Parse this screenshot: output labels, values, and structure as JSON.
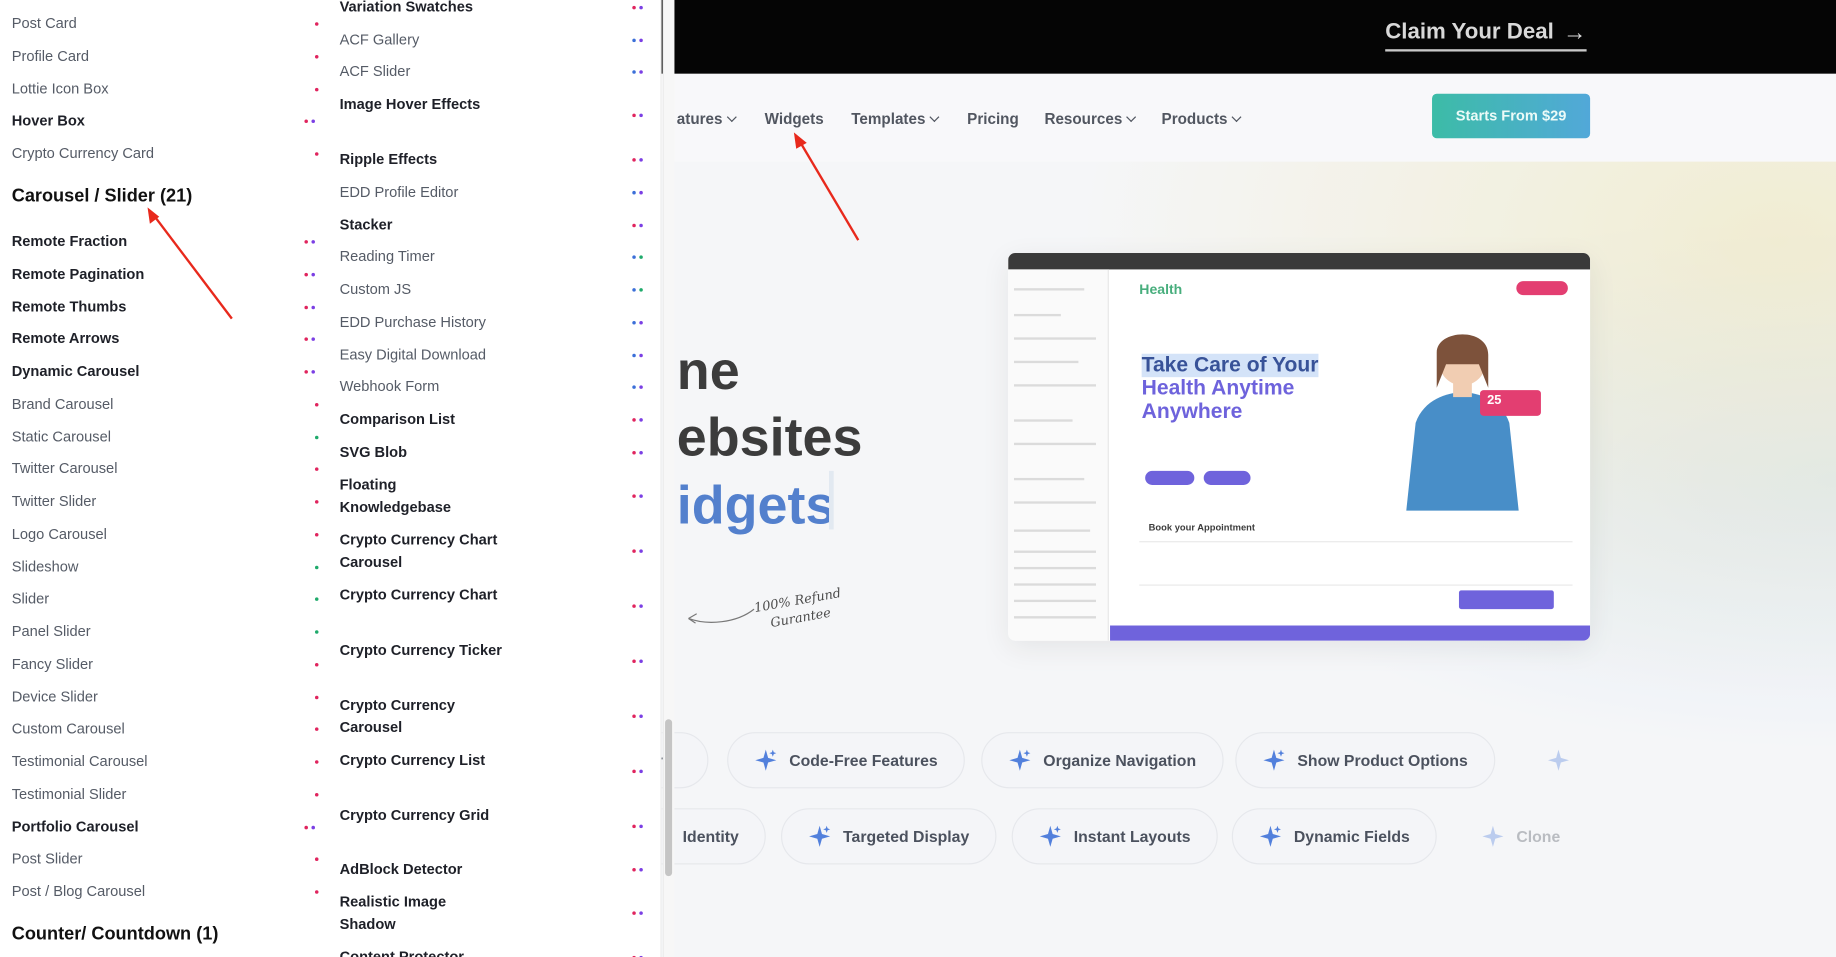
{
  "promo": {
    "claim_label": "Claim Your Deal",
    "arrow_glyph": "→"
  },
  "nav": {
    "items": [
      {
        "label": "atures",
        "dropdown": true
      },
      {
        "label": "Widgets",
        "dropdown": false
      },
      {
        "label": "Templates",
        "dropdown": true
      },
      {
        "label": "Pricing",
        "dropdown": false
      },
      {
        "label": "Resources",
        "dropdown": true
      },
      {
        "label": "Products",
        "dropdown": true
      }
    ],
    "cta_label": "Starts From $29"
  },
  "hero": {
    "line1": "ne",
    "line2": "ebsites",
    "line3": "idgets",
    "refund_line1": "100% Refund",
    "refund_line2": "Gurantee"
  },
  "preview": {
    "logo": "Health",
    "headline_1": "Take Care of Your",
    "headline_2": "Health Anytime",
    "headline_3": "Anywhere",
    "book_label": "Book your Appointment",
    "badge": "25"
  },
  "chips_row1": [
    "r",
    "Code-Free Features",
    "Organize Navigation",
    "Show Product Options"
  ],
  "chips_row2": [
    "Identity",
    "Targeted Display",
    "Instant Layouts",
    "Dynamic Fields",
    "Clone"
  ],
  "panel": {
    "col1_top": [
      {
        "label": "Post Card",
        "bold": false
      },
      {
        "label": "Profile Card",
        "bold": false
      },
      {
        "label": "Lottie Icon Box",
        "bold": false
      },
      {
        "label": "Hover Box",
        "bold": true
      },
      {
        "label": "Crypto Currency Card",
        "bold": false
      }
    ],
    "carousel_heading": "Carousel / Slider (21)",
    "col1_carousel": [
      {
        "label": "Remote Fraction",
        "bold": true
      },
      {
        "label": "Remote Pagination",
        "bold": true
      },
      {
        "label": "Remote Thumbs",
        "bold": true
      },
      {
        "label": "Remote Arrows",
        "bold": true
      },
      {
        "label": "Dynamic Carousel",
        "bold": true
      },
      {
        "label": "Brand Carousel",
        "bold": false
      },
      {
        "label": "Static Carousel",
        "bold": false
      },
      {
        "label": "Twitter Carousel",
        "bold": false
      },
      {
        "label": "Twitter Slider",
        "bold": false
      },
      {
        "label": "Logo Carousel",
        "bold": false
      },
      {
        "label": "Slideshow",
        "bold": false
      },
      {
        "label": "Slider",
        "bold": false
      },
      {
        "label": "Panel Slider",
        "bold": false
      },
      {
        "label": "Fancy Slider",
        "bold": false
      },
      {
        "label": "Device Slider",
        "bold": false
      },
      {
        "label": "Custom Carousel",
        "bold": false
      },
      {
        "label": "Testimonial Carousel",
        "bold": false
      },
      {
        "label": "Testimonial Slider",
        "bold": false
      },
      {
        "label": "Portfolio Carousel",
        "bold": true
      },
      {
        "label": "Post Slider",
        "bold": false
      },
      {
        "label": "Post / Blog Carousel",
        "bold": false
      }
    ],
    "counter_heading": "Counter/ Countdown (1)",
    "col2": [
      {
        "label": "Variation Swatches",
        "bold": true
      },
      {
        "label": "ACF Gallery",
        "bold": false
      },
      {
        "label": "ACF Slider",
        "bold": false
      },
      {
        "label": "Image Hover Effects",
        "bold": true
      },
      {
        "label": "Ripple Effects",
        "bold": true
      },
      {
        "label": "EDD Profile Editor",
        "bold": false
      },
      {
        "label": "Stacker",
        "bold": true
      },
      {
        "label": "Reading Timer",
        "bold": false
      },
      {
        "label": "Custom JS",
        "bold": false
      },
      {
        "label": "EDD Purchase History",
        "bold": false
      },
      {
        "label": "Easy Digital Download",
        "bold": false
      },
      {
        "label": "Webhook Form",
        "bold": false
      },
      {
        "label": "Comparison List",
        "bold": true
      },
      {
        "label": "SVG Blob",
        "bold": true
      },
      {
        "label": "Floating Knowledgebase",
        "bold": true
      },
      {
        "label": "Crypto Currency Chart Carousel",
        "bold": true
      },
      {
        "label": "Crypto Currency Chart",
        "bold": true
      },
      {
        "label": "Crypto Currency Ticker",
        "bold": true
      },
      {
        "label": "Crypto Currency Carousel",
        "bold": true
      },
      {
        "label": "Crypto Currency List",
        "bold": true
      },
      {
        "label": "Crypto Currency Grid",
        "bold": true
      },
      {
        "label": "AdBlock Detector",
        "bold": true
      },
      {
        "label": "Realistic Image Shadow",
        "bold": true
      },
      {
        "label": "Content Protector",
        "bold": true
      }
    ]
  },
  "colors": {
    "dot_pink": "#e0245e",
    "dot_purple": "#7b3fe4",
    "dot_blue": "#3b6fd8",
    "dot_green": "#1faa6b",
    "arrow_red": "#e8291c",
    "cta_start": "#22b39b",
    "cta_end": "#3a9dd4"
  }
}
